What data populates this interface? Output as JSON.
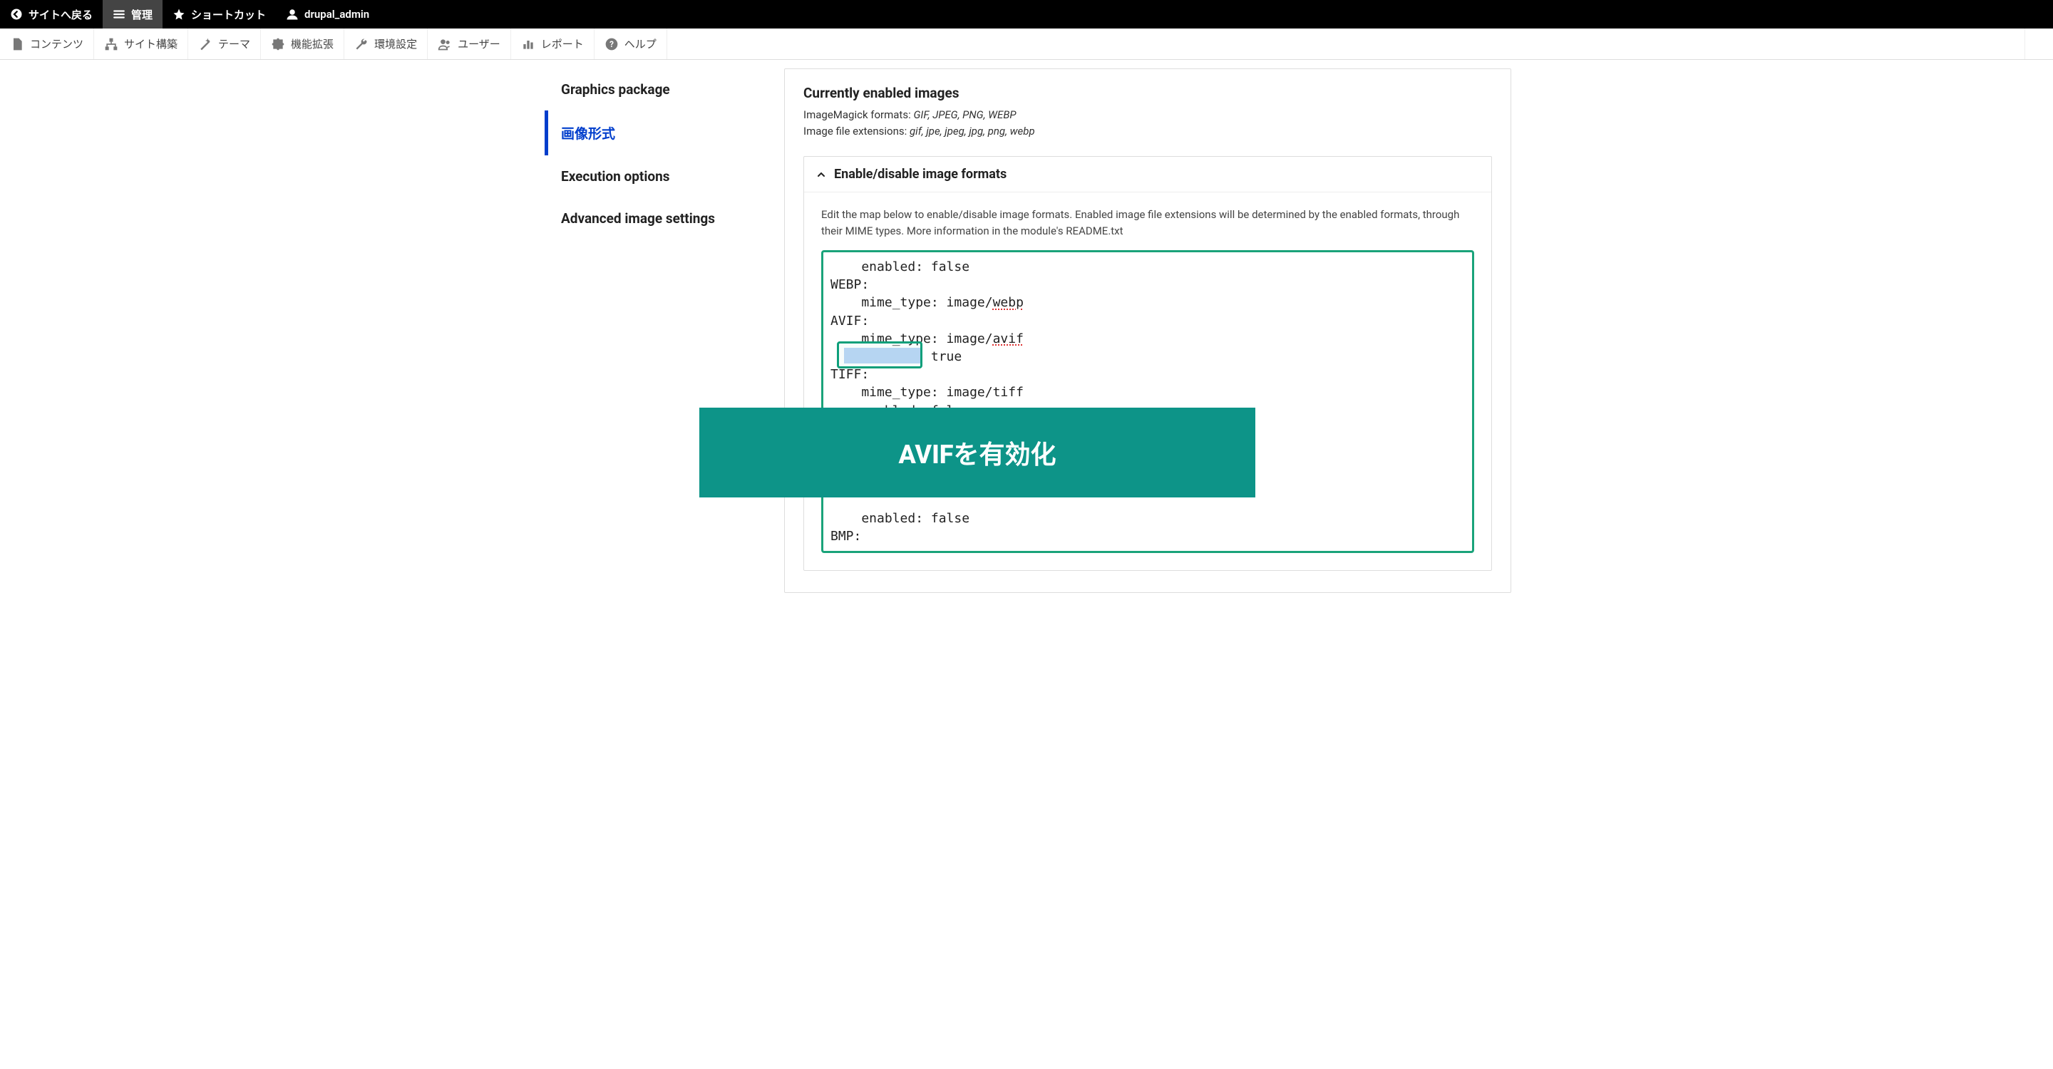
{
  "topbar": {
    "back_label": "サイトへ戻る",
    "manage_label": "管理",
    "shortcuts_label": "ショートカット",
    "username": "drupal_admin"
  },
  "menubar": {
    "content": "コンテンツ",
    "structure": "サイト構築",
    "appearance": "テーマ",
    "extend": "機能拡張",
    "config": "環境設定",
    "people": "ユーザー",
    "reports": "レポート",
    "help": "ヘルプ"
  },
  "sidebar": {
    "items": [
      {
        "label": "Graphics package"
      },
      {
        "label": "画像形式"
      },
      {
        "label": "Execution options"
      },
      {
        "label": "Advanced image settings"
      }
    ],
    "active_index": 1
  },
  "main": {
    "currently_enabled_heading": "Currently enabled images",
    "formats_label": "ImageMagick formats: ",
    "formats_value": "GIF, JPEG, PNG, WEBP",
    "extensions_label": "Image file extensions: ",
    "extensions_value": "gif, jpe, jpeg, jpg, png, webp",
    "details_title": "Enable/disable image formats",
    "description": "Edit the map below to enable/disable image formats. Enabled image file extensions will be determined by the enabled formats, through their MIME types. More information in the module's README.txt",
    "yaml_lines": [
      "    enabled: false",
      "WEBP:",
      "    mime_type: image/webp",
      "AVIF:",
      "    mime_type: image/avif",
      "    enabled: true",
      "TIFF:",
      "    mime_type: image/tiff",
      "    enabled: false",
      "",
      "",
      "",
      "",
      "",
      "    enabled: false",
      "BMP:"
    ]
  },
  "overlay": {
    "banner_label": "AVIFを有効化"
  }
}
